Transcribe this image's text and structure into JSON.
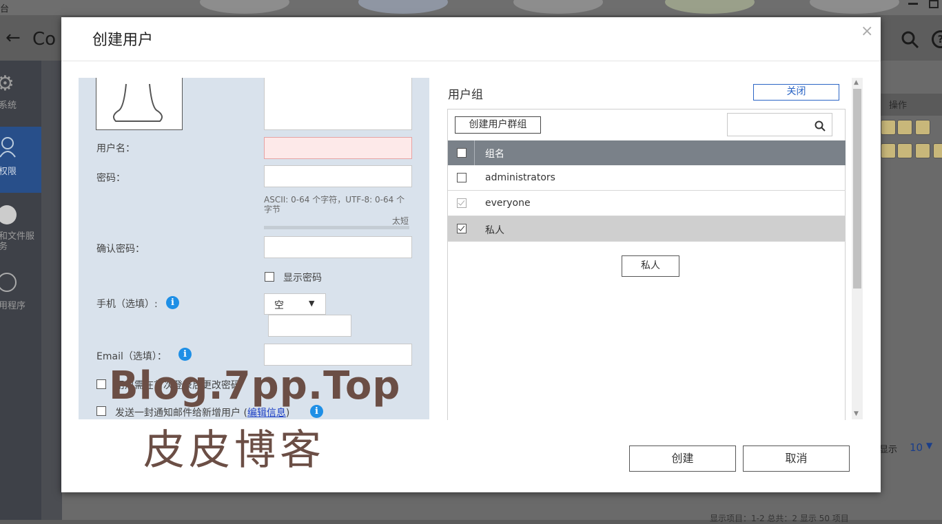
{
  "background": {
    "window_title": "台",
    "header_title": "Co",
    "sidebar": [
      {
        "label": "系统",
        "icon": "gear-icon"
      },
      {
        "label": "权限",
        "icon": "user-icon"
      },
      {
        "label": "和文件服务",
        "icon": "globe-icon"
      },
      {
        "label": "用程序",
        "icon": "apps-icon"
      }
    ],
    "col_ops": "操作",
    "show_label": "显示",
    "show_value": "10",
    "bottom_text": "显示项目：1-2 总共：2   显示 50  项目"
  },
  "modal": {
    "title": "创建用户",
    "close_symbol": "×",
    "form": {
      "username_label": "用户名：",
      "password_label": "密码：",
      "password_hint": "ASCII: 0-64 个字符，UTF-8: 0-64 个字节",
      "strength_text": "太短",
      "confirm_label": "确认密码：",
      "show_password_label": "显示密码",
      "phone_label": "手机（选填）:",
      "phone_select_value": "空",
      "email_label": "Email（选填）：",
      "must_change_label": "用户需在首次登录后更改密码",
      "notify_label": "发送一封通知邮件给新增用户 (",
      "notify_link": "编辑信息",
      "notify_close": ")"
    },
    "groups": {
      "title": "用户组",
      "close_button": "关闭",
      "create_group_button": "创建用户群组",
      "column_name": "组名",
      "rows": [
        {
          "name": "administrators",
          "checked": false,
          "disabled": false
        },
        {
          "name": "everyone",
          "checked": true,
          "disabled": true
        },
        {
          "name": "私人",
          "checked": true,
          "disabled": false
        }
      ],
      "tag_button": "私人"
    },
    "create_button": "创建",
    "cancel_button": "取消"
  },
  "watermark": {
    "line1": "Blog.7pp.Top",
    "line2": "皮皮博客"
  }
}
